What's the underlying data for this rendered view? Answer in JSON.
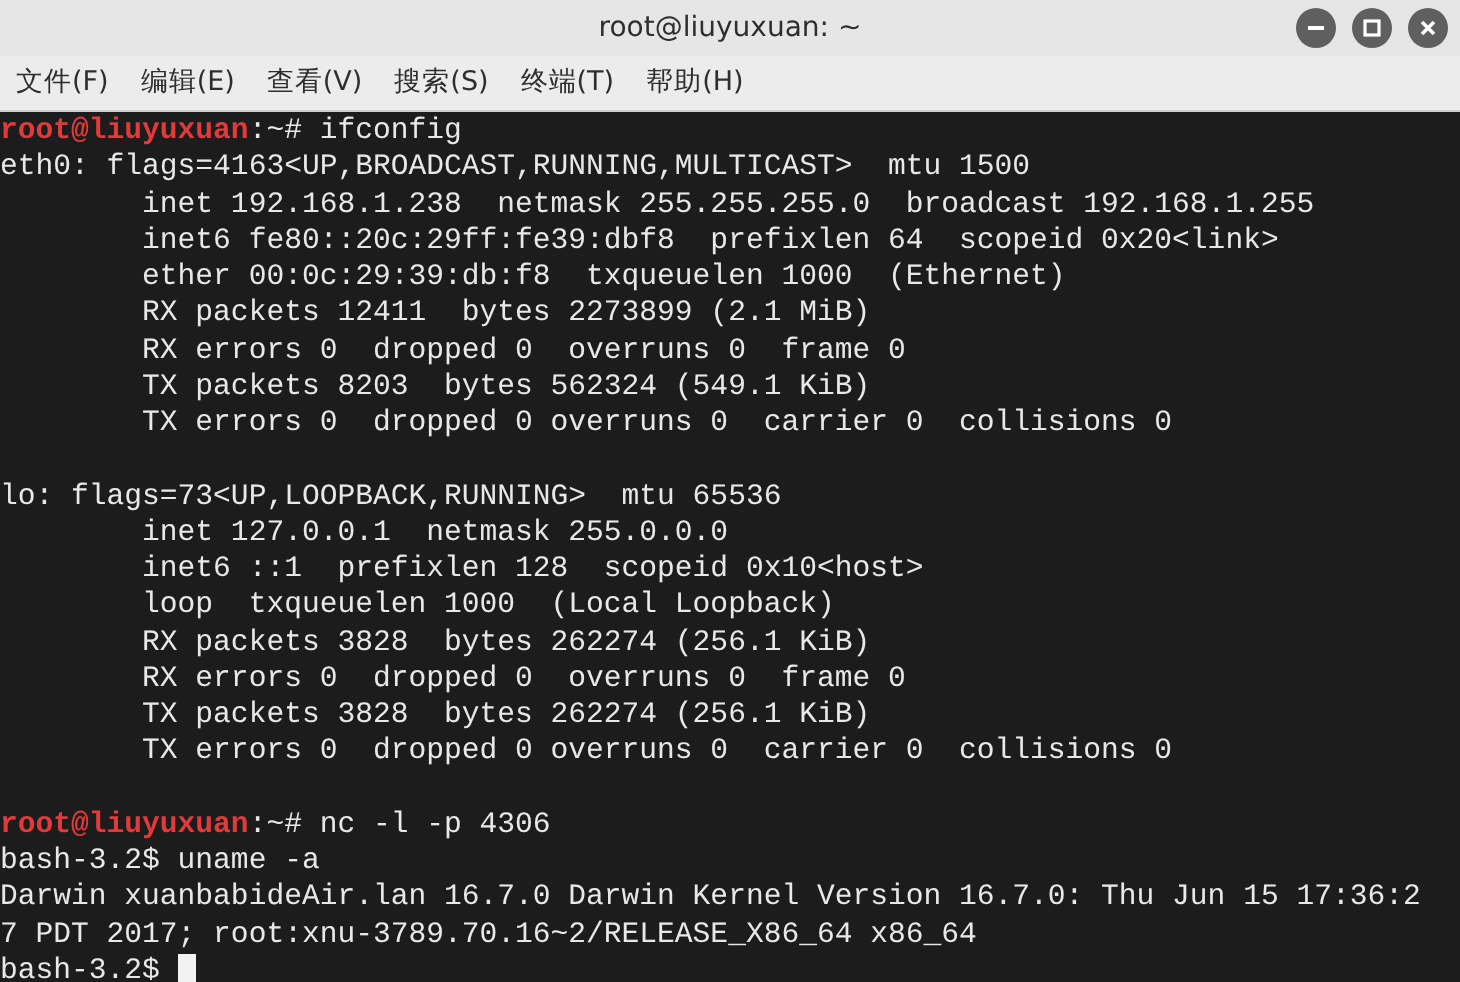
{
  "window": {
    "title": "root@liuyuxuan: ~"
  },
  "menu": [
    "文件(F)",
    "编辑(E)",
    "查看(V)",
    "搜索(S)",
    "终端(T)",
    "帮助(H)"
  ],
  "terminal": {
    "cursor_visible": true,
    "lines": [
      {
        "kind": "prompt",
        "user": "root@liuyuxuan",
        "path": ":~#",
        "command": " ifconfig"
      },
      {
        "kind": "output",
        "text": "eth0: flags=4163<UP,BROADCAST,RUNNING,MULTICAST>  mtu 1500"
      },
      {
        "kind": "output",
        "text": "        inet 192.168.1.238  netmask 255.255.255.0  broadcast 192.168.1.255"
      },
      {
        "kind": "output",
        "text": "        inet6 fe80::20c:29ff:fe39:dbf8  prefixlen 64  scopeid 0x20<link>"
      },
      {
        "kind": "output",
        "text": "        ether 00:0c:29:39:db:f8  txqueuelen 1000  (Ethernet)"
      },
      {
        "kind": "output",
        "text": "        RX packets 12411  bytes 2273899 (2.1 MiB)"
      },
      {
        "kind": "output",
        "text": "        RX errors 0  dropped 0  overruns 0  frame 0"
      },
      {
        "kind": "output",
        "text": "        TX packets 8203  bytes 562324 (549.1 KiB)"
      },
      {
        "kind": "output",
        "text": "        TX errors 0  dropped 0 overruns 0  carrier 0  collisions 0"
      },
      {
        "kind": "blank"
      },
      {
        "kind": "output",
        "text": "lo: flags=73<UP,LOOPBACK,RUNNING>  mtu 65536"
      },
      {
        "kind": "output",
        "text": "        inet 127.0.0.1  netmask 255.0.0.0"
      },
      {
        "kind": "output",
        "text": "        inet6 ::1  prefixlen 128  scopeid 0x10<host>"
      },
      {
        "kind": "output",
        "text": "        loop  txqueuelen 1000  (Local Loopback)"
      },
      {
        "kind": "output",
        "text": "        RX packets 3828  bytes 262274 (256.1 KiB)"
      },
      {
        "kind": "output",
        "text": "        RX errors 0  dropped 0  overruns 0  frame 0"
      },
      {
        "kind": "output",
        "text": "        TX packets 3828  bytes 262274 (256.1 KiB)"
      },
      {
        "kind": "output",
        "text": "        TX errors 0  dropped 0 overruns 0  carrier 0  collisions 0"
      },
      {
        "kind": "blank"
      },
      {
        "kind": "prompt",
        "user": "root@liuyuxuan",
        "path": ":~#",
        "command": " nc -l -p 4306"
      },
      {
        "kind": "output",
        "text": "bash-3.2$ uname -a"
      },
      {
        "kind": "output",
        "text": "Darwin xuanbabideAir.lan 16.7.0 Darwin Kernel Version 16.7.0: Thu Jun 15 17:36:2"
      },
      {
        "kind": "output",
        "text": "7 PDT 2017; root:xnu-3789.70.16~2/RELEASE_X86_64 x86_64"
      },
      {
        "kind": "output",
        "text": "bash-3.2$ "
      }
    ]
  }
}
